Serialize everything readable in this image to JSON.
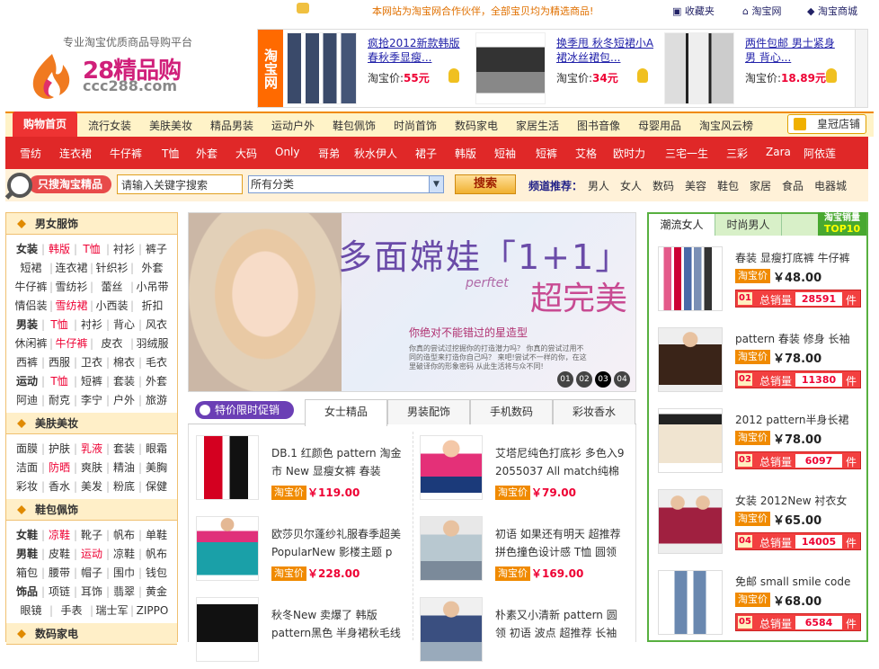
{
  "topbar": {
    "notice": "本网站为淘宝网合作伙伴，全部宝贝均为精选商品!",
    "links": [
      "收藏夹",
      "淘宝网",
      "淘宝商城"
    ]
  },
  "logo": {
    "tagline": "专业淘宝优质商品导购平台",
    "name": "28精品购",
    "domain": "ccc288.com"
  },
  "ads": {
    "side_label": "淘宝网",
    "items": [
      {
        "title": "疯抢2012新款韩版春秋季显瘦...",
        "price_label": "淘宝价:",
        "price": "55元"
      },
      {
        "title": "换季甩 秋冬短裙小A裙冰丝裙包...",
        "price_label": "淘宝价:",
        "price": "34元"
      },
      {
        "title": "两件包邮 男士紧身 男 背心...",
        "price_label": "淘宝价:",
        "price": "18.89元"
      }
    ]
  },
  "mainnav": {
    "home": "购物首页",
    "items": [
      "流行女装",
      "美肤美妆",
      "精品男装",
      "运动户外",
      "鞋包佩饰",
      "时尚首饰",
      "数码家电",
      "家居生活",
      "图书音像",
      "母婴用品",
      "淘宝风云榜"
    ],
    "crown": "皇冠店铺"
  },
  "subnav": [
    "雪纺",
    "连衣裙",
    "牛仔裤",
    "T恤",
    "外套",
    "大码",
    "Only",
    "哥弟",
    "秋水伊人",
    "裙子",
    "韩版",
    "短袖",
    "短裤",
    "艾格",
    "欧时力",
    "三宅一生",
    "三彩",
    "Zara",
    "阿依莲"
  ],
  "search": {
    "label": "只搜淘宝精品",
    "input_value": "请输入关键字搜索",
    "category": "所有分类",
    "button": "搜索",
    "channel_label": "频道推荐：",
    "channels": [
      "男人",
      "女人",
      "数码",
      "美容",
      "鞋包",
      "家居",
      "食品",
      "电器城"
    ]
  },
  "sidebar": {
    "sections": [
      {
        "title": "男女服饰",
        "rows": [
          [
            "女装",
            "韩版",
            "T恤",
            "衬衫",
            "裤子"
          ],
          [
            "短裙",
            "连衣裙",
            "针织衫",
            "外套"
          ],
          [
            "牛仔裤",
            "雪纺衫",
            "蕾丝",
            "小吊带"
          ],
          [
            "情侣装",
            "雪纺裙",
            "小西装",
            "折扣"
          ],
          [
            "男装",
            "T恤",
            "衬衫",
            "背心",
            "风衣"
          ],
          [
            "休闲裤",
            "牛仔裤",
            "皮衣",
            "羽绒服"
          ],
          [
            "西裤",
            "西服",
            "卫衣",
            "棉衣",
            "毛衣"
          ],
          [
            "运动",
            "T恤",
            "短裤",
            "套装",
            "外套"
          ],
          [
            "阿迪",
            "耐克",
            "李宁",
            "户外",
            "旅游"
          ]
        ]
      },
      {
        "title": "美肤美妆",
        "rows": [
          [
            "面膜",
            "护肤",
            "乳液",
            "套装",
            "眼霜"
          ],
          [
            "洁面",
            "防晒",
            "爽肤",
            "精油",
            "美胸"
          ],
          [
            "彩妆",
            "香水",
            "美发",
            "粉底",
            "保健"
          ]
        ]
      },
      {
        "title": "鞋包佩饰",
        "rows": [
          [
            "女鞋",
            "凉鞋",
            "靴子",
            "帆布",
            "单鞋"
          ],
          [
            "男鞋",
            "皮鞋",
            "运动",
            "凉鞋",
            "帆布"
          ],
          [
            "箱包",
            "腰带",
            "帽子",
            "围巾",
            "钱包"
          ],
          [
            "饰品",
            "项链",
            "耳饰",
            "翡翠",
            "黄金"
          ],
          [
            "眼镜",
            "手表",
            "瑞士军刀",
            "ZIPPO"
          ]
        ]
      },
      {
        "title": "数码家电",
        "rows": []
      }
    ]
  },
  "banner": {
    "headline": "多面嫦娃「1+1」",
    "perfect": "perftet",
    "super": "超完美",
    "sub": "你绝对不能错过的星造型",
    "small": "你真的尝试过挖掘你的打造潜力吗？ 你真的尝试过用不同的造型来打造你自己吗？ 来吧!尝试不一样的你，在这里破译你的形象密码 从此生活将与众不同!",
    "dots": [
      "01",
      "02",
      "03",
      "04"
    ]
  },
  "tabs": {
    "promo": "特价限时促销",
    "items": [
      "女士精品",
      "男装配饰",
      "手机数码",
      "彩妆香水"
    ]
  },
  "products": [
    {
      "title": "DB.1 红颜色 pattern 淘金市 New 显瘦女裤 春装",
      "tag": "淘宝价",
      "price": "￥119.00"
    },
    {
      "title": "艾塔尼纯色打底衫 多色入9 2055037 All match纯棉",
      "tag": "淘宝价",
      "price": "￥79.00"
    },
    {
      "title": "欧莎贝尔蓬纱礼服春季超美 PopularNew 影楼主题 p",
      "tag": "淘宝价",
      "price": "￥228.00"
    },
    {
      "title": "初语 如果还有明天 超推荐 拼色撞色设计感 T恤 圆领",
      "tag": "淘宝价",
      "price": "￥169.00"
    },
    {
      "title": "秋冬New 卖爆了 韩版 pattern黑色 半身裙秋毛线裙",
      "tag": "淘宝价",
      "price": ""
    },
    {
      "title": "朴素又小清新 pattern 圆领 初语 波点 超推荐 长袖",
      "tag": "淘宝价",
      "price": ""
    }
  ],
  "rightcol": {
    "tabs": [
      "潮流女人",
      "时尚男人"
    ],
    "badge": "淘宝销量",
    "badge2": "TOP10",
    "items": [
      {
        "title": "春装 显瘦打底裤 牛仔裤",
        "tag": "淘宝价",
        "price": "￥48.00",
        "rank": "01",
        "label": "总销量",
        "count": "28591",
        "unit": "件"
      },
      {
        "title": "pattern 春装 修身 长袖",
        "tag": "淘宝价",
        "price": "￥78.00",
        "rank": "02",
        "label": "总销量",
        "count": "11380",
        "unit": "件"
      },
      {
        "title": "2012 pattern半身长裙",
        "tag": "淘宝价",
        "price": "￥78.00",
        "rank": "03",
        "label": "总销量",
        "count": "6097",
        "unit": "件"
      },
      {
        "title": "女装 2012New 衬衣女",
        "tag": "淘宝价",
        "price": "￥65.00",
        "rank": "04",
        "label": "总销量",
        "count": "14005",
        "unit": "件"
      },
      {
        "title": "免邮 small smile code",
        "tag": "淘宝价",
        "price": "￥68.00",
        "rank": "05",
        "label": "总销量",
        "count": "6584",
        "unit": "件"
      }
    ]
  }
}
